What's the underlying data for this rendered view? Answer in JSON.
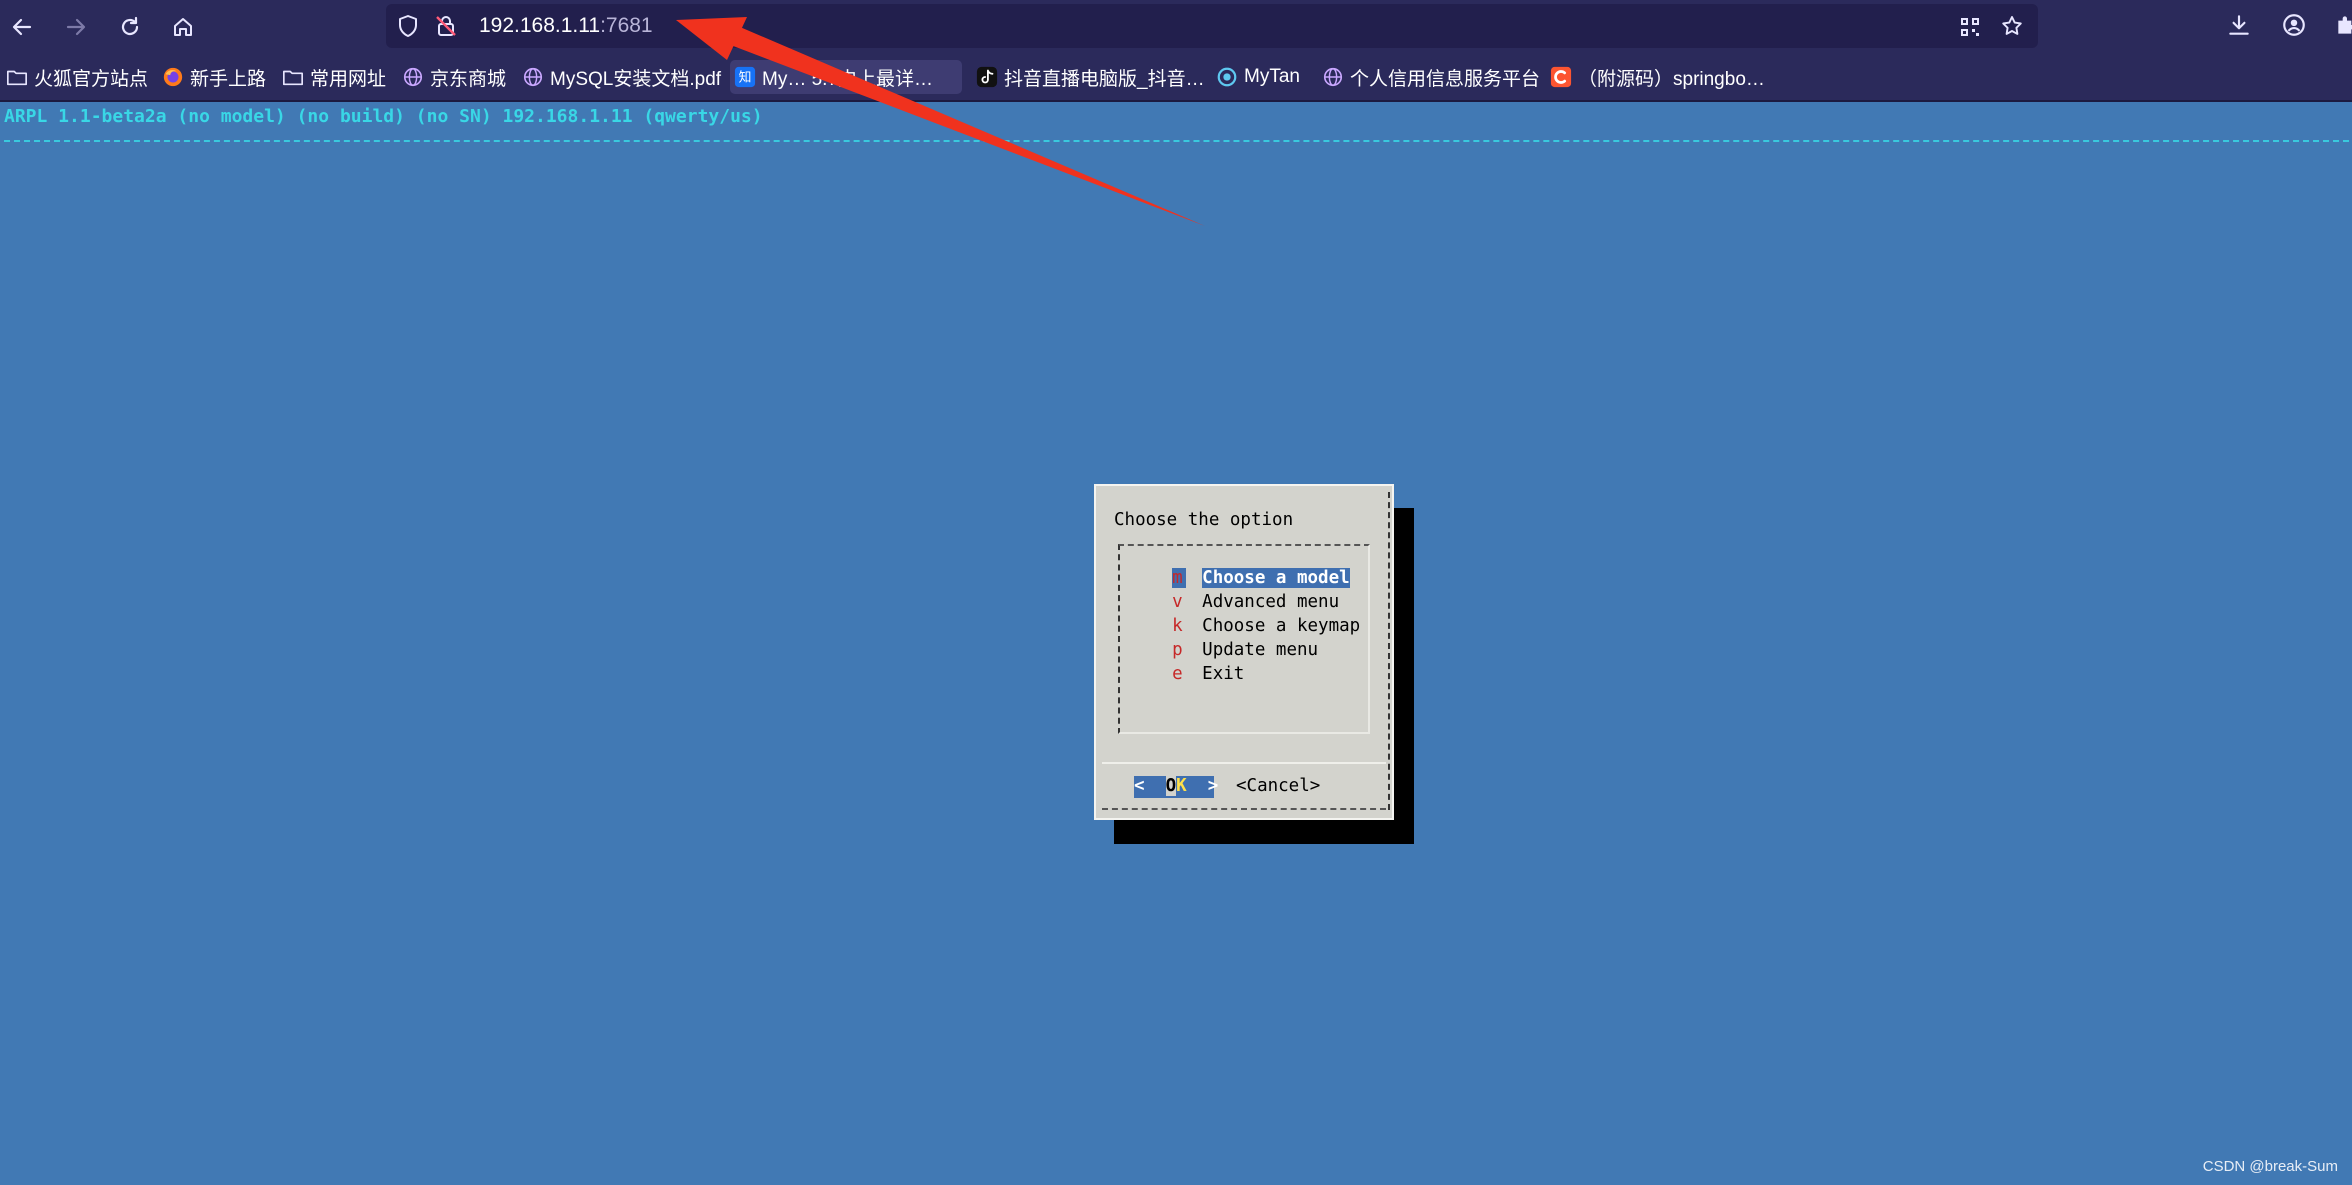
{
  "browser": {
    "url_host": "192.168.1.11",
    "url_port": ":7681",
    "icons": [
      "back-arrow-icon",
      "forward-arrow-icon",
      "reload-icon",
      "home-icon",
      "shield-icon",
      "insecure-lock-icon",
      "qr-code-icon",
      "star-icon",
      "download-icon",
      "account-icon"
    ]
  },
  "bookmarks": [
    {
      "label": "火狐官方站点",
      "icon": "folder-icon"
    },
    {
      "label": "新手上路",
      "icon": "firefox-icon"
    },
    {
      "label": "常用网址",
      "icon": "folder-icon"
    },
    {
      "label": "京东商城",
      "icon": "globe-icon"
    },
    {
      "label": "MySQL安装文档.pdf",
      "icon": "globe-icon"
    },
    {
      "label": "My…  5.7史上最详…",
      "icon": "zhihu-icon"
    },
    {
      "label": "抖音直播电脑版_抖音…",
      "icon": "tiktok-icon"
    },
    {
      "label": "MyTan",
      "icon": "mytan-icon"
    },
    {
      "label": "个人信用信息服务平台",
      "icon": "globe-icon"
    },
    {
      "label": "（附源码）springbo…",
      "icon": "csdn-icon"
    }
  ],
  "terminal": {
    "title_line": "ARPL 1.1-beta2a (no model) (no build) (no SN) 192.168.1.11 (qwerty/us)",
    "dialog": {
      "title": "Choose the option",
      "items": [
        {
          "key": "m",
          "label": "Choose a model",
          "selected": true
        },
        {
          "key": "v",
          "label": "Advanced menu",
          "selected": false
        },
        {
          "key": "k",
          "label": "Choose a keymap",
          "selected": false
        },
        {
          "key": "p",
          "label": "Update menu",
          "selected": false
        },
        {
          "key": "e",
          "label": "Exit",
          "selected": false
        }
      ],
      "ok_button": {
        "left": "<  ",
        "o": "O",
        "k": "K",
        "right": "  >"
      },
      "cancel_button": "<Cancel>"
    }
  },
  "annotation": {
    "color": "#f0321e"
  },
  "watermark": "CSDN @break-Sum"
}
